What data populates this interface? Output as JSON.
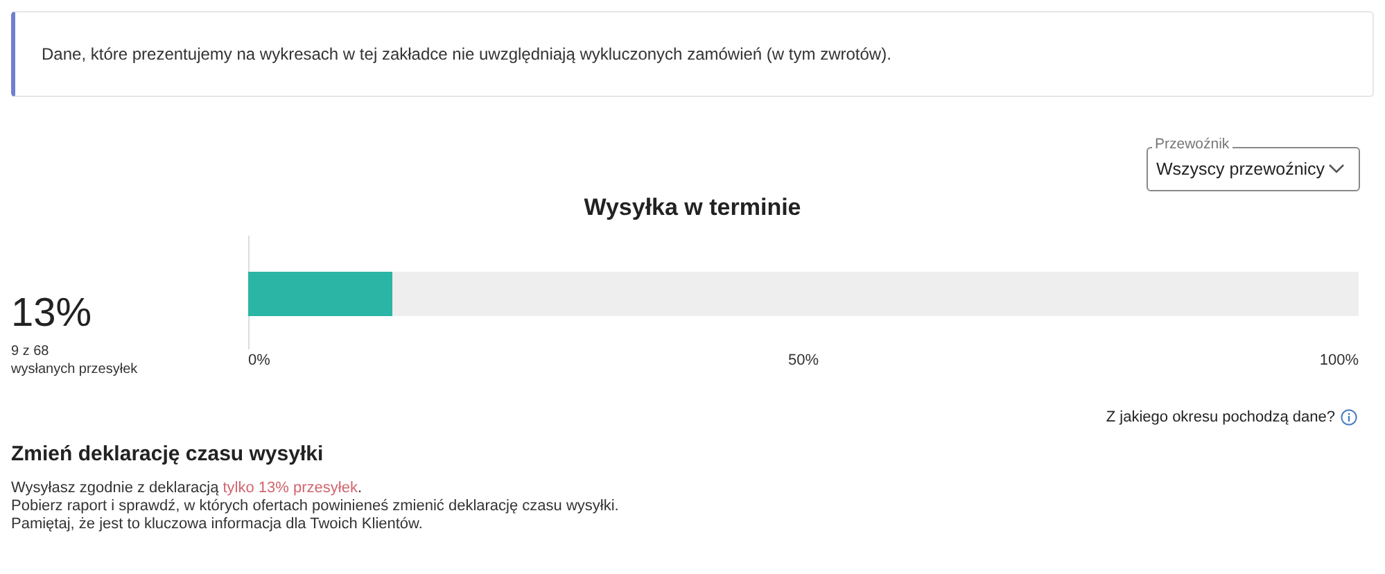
{
  "notice": {
    "text": "Dane, które prezentujemy na wykresach w tej zakładce nie uwzględniają wykluczonych zamówień (w tym zwrotów)."
  },
  "carrier_filter": {
    "label": "Przewoźnik",
    "value": "Wszyscy przewoźnicy"
  },
  "chart": {
    "title": "Wysyłka w terminie",
    "percent": "13%",
    "count": "9 z 68",
    "caption": "wysłanych przesyłek",
    "level": 0.13,
    "ticks": [
      "0%",
      "50%",
      "100%"
    ]
  },
  "data_period_link": {
    "text": "Z jakiego okresu pochodzą dane?"
  },
  "declaration": {
    "heading": "Zmień deklarację czasu wysyłki",
    "lines": [
      {
        "before": "Wysyłasz zgodnie z deklaracją ",
        "highlight": "tylko 13% przesyłek",
        "after": "."
      },
      {
        "before": "Pobierz raport i sprawdź, w których ofertach powinieneś zmienić deklarację czasu wysyłki."
      },
      {
        "before": "Pamiętaj, że jest to kluczowa informacja dla Twoich Klientów."
      }
    ]
  }
}
